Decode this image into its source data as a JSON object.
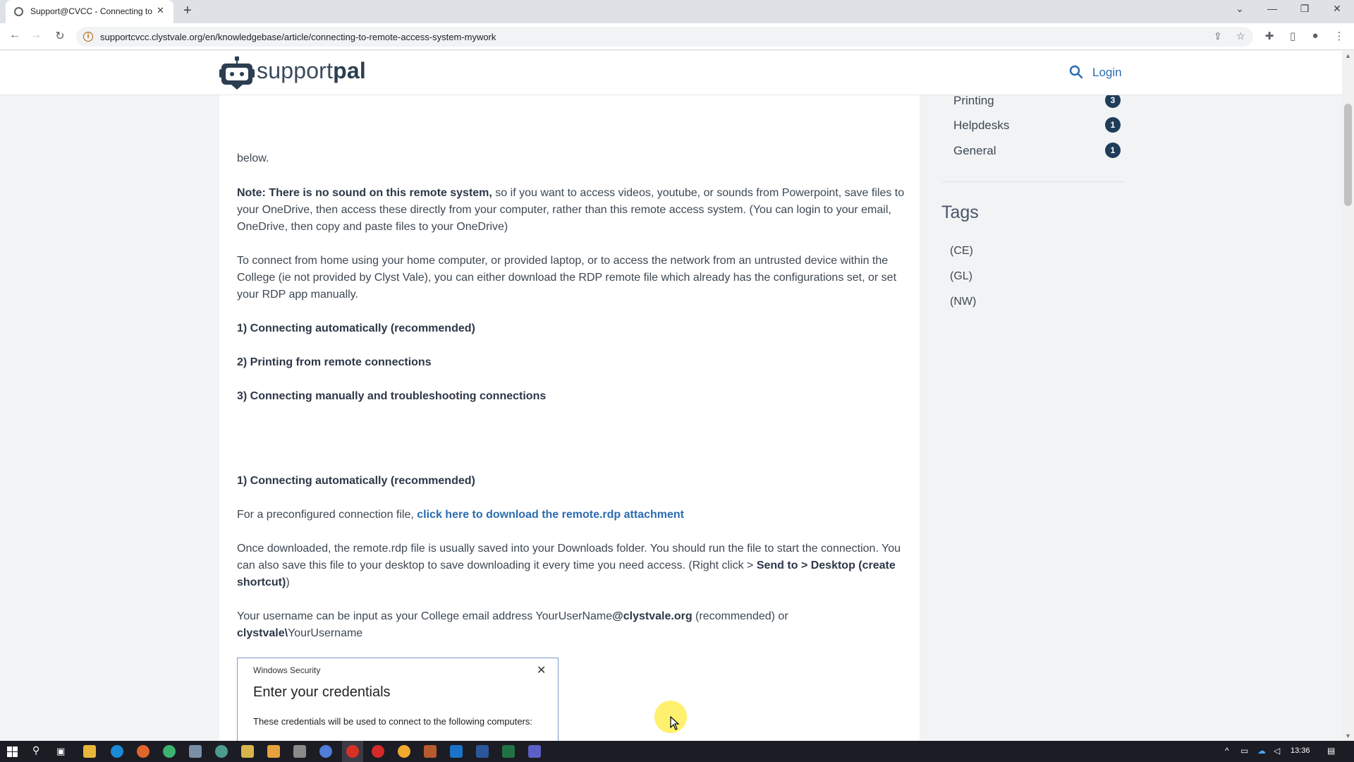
{
  "browser": {
    "tab_title": "Support@CVCC - Connecting to",
    "url": "supportcvcc.clystvale.org/en/knowledgebase/article/connecting-to-remote-access-system-mywork"
  },
  "header": {
    "logo_text_light": "support",
    "logo_text_bold": "pal",
    "login_label": "Login"
  },
  "article": {
    "partial_line": "below.",
    "note_bold": "Note:  There is no sound on this remote system,",
    "note_rest": " so if you want to access videos, youtube, or sounds from Powerpoint, save files to your OneDrive, then access these directly from your computer, rather than this remote access system. (You can login to your email, OneDrive, then copy and paste files to your OneDrive)",
    "connect_intro": "To connect from home using your home computer, or provided laptop, or to access the network from an untrusted device within the College (ie not provided by Clyst Vale), you can either download the RDP remote file which already has the configurations set, or set your RDP app manually.",
    "toc": [
      "1) Connecting automatically (recommended)",
      "2) Printing from remote connections",
      "3) Connecting manually and troubleshooting connections"
    ],
    "section1_heading": "1) Connecting automatically (recommended)",
    "preconfig_text": "For a preconfigured connection file, ",
    "download_link": "click here to download the remote.rdp attachment",
    "once_text": "Once downloaded, the remote.rdp file is usually saved into your Downloads folder. You should run the file to start the connection.  You can also save this file to your desktop to save downloading it every time you need access.  (Right click > ",
    "once_bold": "Send to > Desktop (create shortcut)",
    "once_end": ")",
    "username_text": "Your username can be input as your College email address YourUserName",
    "username_domain": "@clystvale.org",
    "username_mid": " (recommended) or ",
    "username_prefix": "clystvale\\",
    "username_suffix": "YourUsername"
  },
  "dialog": {
    "caption": "Windows Security",
    "title": "Enter your credentials",
    "body": "These credentials will be used to connect to the following computers:"
  },
  "sidebar": {
    "categories": [
      {
        "label": "Printing",
        "count": "3"
      },
      {
        "label": "Helpdesks",
        "count": "1"
      },
      {
        "label": "General",
        "count": "1"
      }
    ],
    "tags_heading": "Tags",
    "tags": [
      "(CE)",
      "(GL)",
      "(NW)"
    ]
  },
  "taskbar": {
    "clock": "13:36"
  },
  "colors": {
    "link": "#2b6cb0",
    "badge": "#1f3d5a",
    "page_bg": "#f1f3f5"
  }
}
